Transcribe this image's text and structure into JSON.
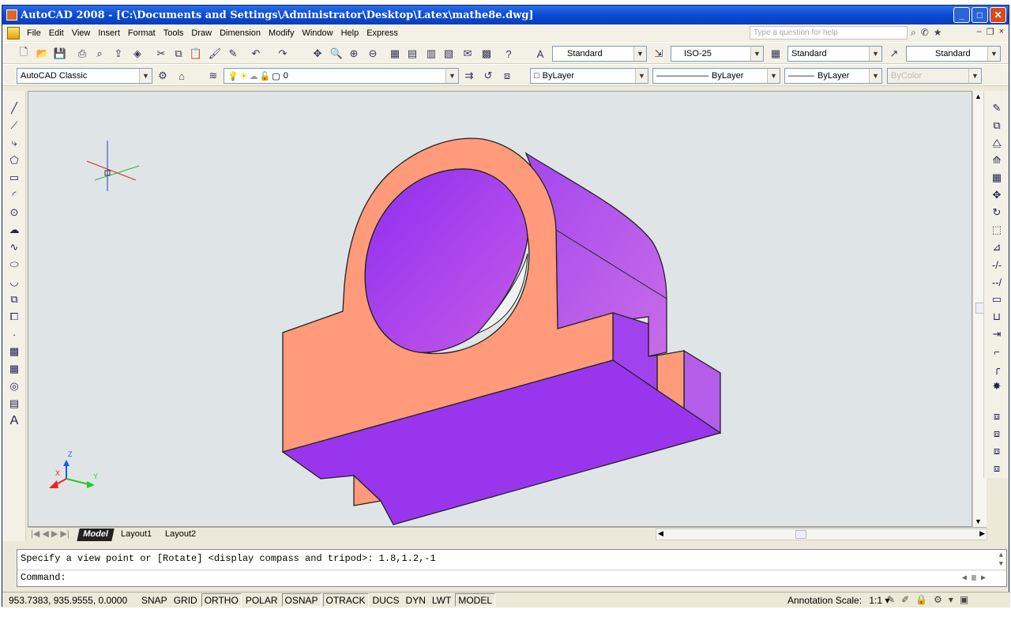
{
  "window": {
    "title": "AutoCAD 2008 - [C:\\Documents and Settings\\Administrator\\Desktop\\Latex\\mathe8e.dwg]"
  },
  "menu": [
    "File",
    "Edit",
    "View",
    "Insert",
    "Format",
    "Tools",
    "Draw",
    "Dimension",
    "Modify",
    "Window",
    "Help",
    "Express"
  ],
  "help": {
    "placeholder": "Type a question for help"
  },
  "toolbar": {
    "text_style": "Standard",
    "dim_style": "ISO-25",
    "table_style": "Standard",
    "multileader_style": "Standard",
    "workspace": "AutoCAD Classic",
    "layer": "0",
    "color": "ByLayer",
    "linetype": "ByLayer",
    "lineweight": "ByLayer",
    "plotstyle": "ByColor"
  },
  "layout_tabs": [
    "Model",
    "Layout1",
    "Layout2"
  ],
  "ucs": {
    "x": "X",
    "y": "Y",
    "z": "Z"
  },
  "command": {
    "history": "Specify a view point or [Rotate] <display compass and tripod>: 1.8,1.2,-1",
    "prompt": "Command:"
  },
  "status": {
    "coords": "953.7383, 935.9555, 0.0000",
    "toggles": [
      {
        "label": "SNAP",
        "on": false
      },
      {
        "label": "GRID",
        "on": false
      },
      {
        "label": "ORTHO",
        "on": true
      },
      {
        "label": "POLAR",
        "on": false
      },
      {
        "label": "OSNAP",
        "on": true
      },
      {
        "label": "OTRACK",
        "on": true
      },
      {
        "label": "DUCS",
        "on": false
      },
      {
        "label": "DYN",
        "on": false
      },
      {
        "label": "LWT",
        "on": false
      },
      {
        "label": "MODEL",
        "on": true
      }
    ],
    "annotation_label": "Annotation Scale:",
    "annotation_value": "1:1"
  },
  "colors": {
    "face_salmon": "#ff9a7a",
    "face_purple_dark": "#9a35ee",
    "face_purple_light": "#b85af0",
    "canvas_bg": "#dfe5e6"
  }
}
